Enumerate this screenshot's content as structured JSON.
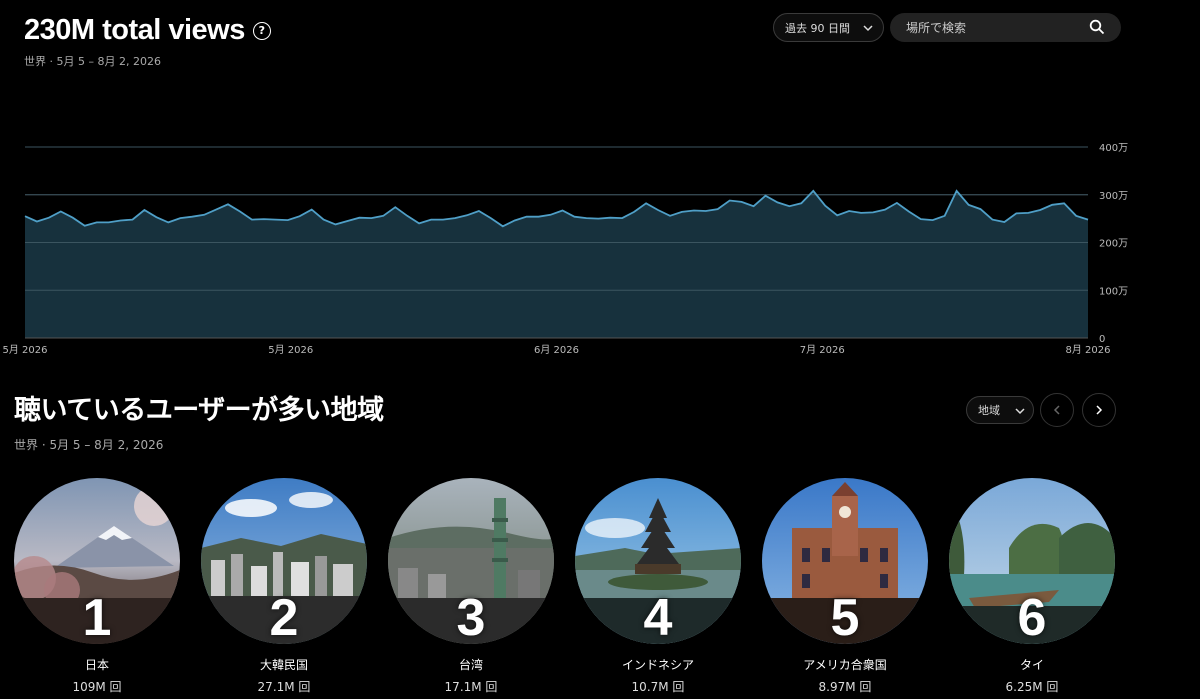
{
  "header": {
    "title": "230M total views",
    "help_icon": "?",
    "subtitle": "世界 · 5月 5 – 8月 2, 2026"
  },
  "controls": {
    "period_label": "過去 90 日間",
    "search_placeholder": "場所で検索"
  },
  "chart_data": {
    "type": "area",
    "color": "#4f9fc7",
    "fill": "#17313d",
    "ylim": [
      0,
      4000000
    ],
    "y_ticks": [
      "0",
      "100万",
      "200万",
      "300万",
      "400万"
    ],
    "x_ticks": [
      "5月 2026",
      "5月 2026",
      "6月 2026",
      "7月 2026",
      "8月 2026"
    ],
    "grid": true,
    "values": [
      2550000,
      2440000,
      2520000,
      2650000,
      2520000,
      2350000,
      2420000,
      2420000,
      2460000,
      2480000,
      2680000,
      2530000,
      2420000,
      2510000,
      2540000,
      2580000,
      2690000,
      2800000,
      2650000,
      2480000,
      2490000,
      2480000,
      2470000,
      2550000,
      2690000,
      2480000,
      2380000,
      2450000,
      2520000,
      2510000,
      2560000,
      2740000,
      2560000,
      2400000,
      2480000,
      2480000,
      2510000,
      2570000,
      2660000,
      2510000,
      2340000,
      2460000,
      2540000,
      2540000,
      2580000,
      2670000,
      2540000,
      2510000,
      2500000,
      2520000,
      2510000,
      2640000,
      2820000,
      2680000,
      2560000,
      2640000,
      2670000,
      2660000,
      2700000,
      2880000,
      2850000,
      2760000,
      2980000,
      2840000,
      2760000,
      2820000,
      3080000,
      2770000,
      2570000,
      2660000,
      2620000,
      2630000,
      2690000,
      2830000,
      2650000,
      2490000,
      2470000,
      2560000,
      3080000,
      2790000,
      2700000,
      2480000,
      2430000,
      2610000,
      2620000,
      2680000,
      2790000,
      2820000,
      2560000,
      2480000
    ]
  },
  "regions_section": {
    "title": "聴いているユーザーが多い地域",
    "subtitle": "世界 · 5月 5 – 8月 2, 2026",
    "filter_label": "地域"
  },
  "regions": [
    {
      "rank": "1",
      "name": "日本",
      "views": "109M 回"
    },
    {
      "rank": "2",
      "name": "大韓民国",
      "views": "27.1M 回"
    },
    {
      "rank": "3",
      "name": "台湾",
      "views": "17.1M 回"
    },
    {
      "rank": "4",
      "name": "インドネシア",
      "views": "10.7M 回"
    },
    {
      "rank": "5",
      "name": "アメリカ合衆国",
      "views": "8.97M 回"
    },
    {
      "rank": "6",
      "name": "タイ",
      "views": "6.25M 回"
    }
  ]
}
